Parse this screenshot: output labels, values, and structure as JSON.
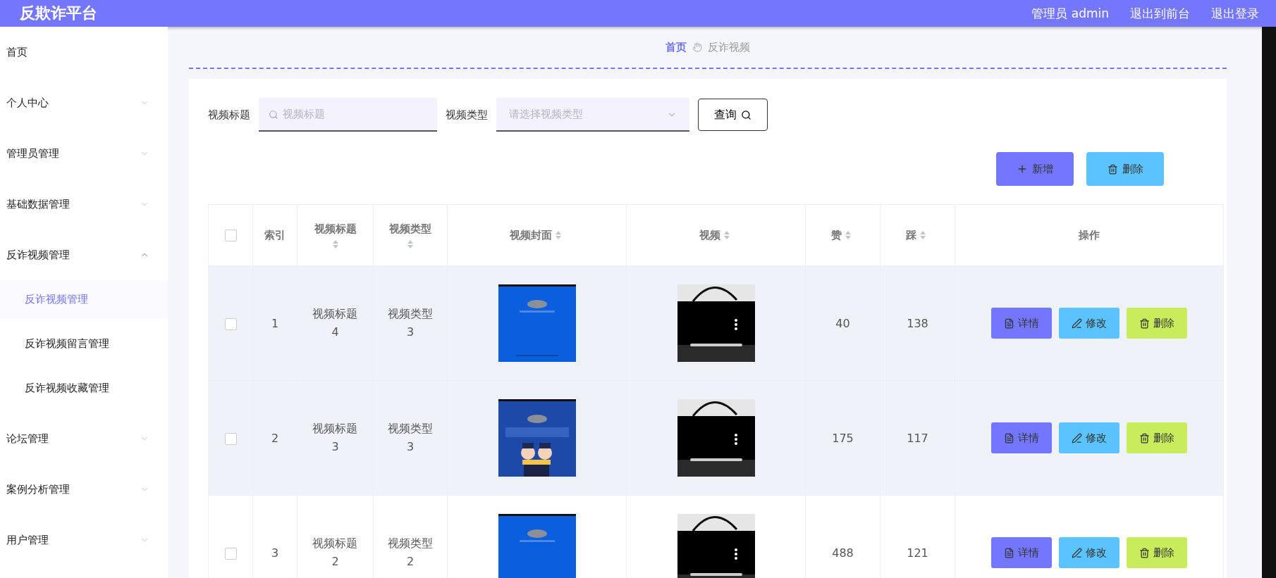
{
  "header": {
    "title": "反欺诈平台",
    "user": "管理员 admin",
    "links": [
      "退出到前台",
      "退出登录"
    ]
  },
  "sidebar": {
    "items": [
      {
        "label": "首页"
      },
      {
        "label": "个人中心",
        "expanded": false
      },
      {
        "label": "管理员管理",
        "expanded": false
      },
      {
        "label": "基础数据管理",
        "expanded": false
      },
      {
        "label": "反诈视频管理",
        "expanded": true,
        "children": [
          {
            "label": "反诈视频管理",
            "selected": true
          },
          {
            "label": "反诈视频留言管理",
            "selected": false
          },
          {
            "label": "反诈视频收藏管理",
            "selected": false
          }
        ]
      },
      {
        "label": "论坛管理",
        "expanded": false
      },
      {
        "label": "案例分析管理",
        "expanded": false
      },
      {
        "label": "用户管理",
        "expanded": false
      }
    ]
  },
  "breadcrumb": [
    "首页",
    "反诈视频"
  ],
  "search": {
    "title_label": "视频标题",
    "title_placeholder": "视频标题",
    "type_label": "视频类型",
    "type_placeholder": "请选择视频类型",
    "query_button": "查询"
  },
  "actions": [
    "新增",
    "删除"
  ],
  "table": {
    "select_all_checked": false,
    "columns": [
      {
        "label": "索引",
        "sortable": false
      },
      {
        "label": "视频标题",
        "sortable": true
      },
      {
        "label": "视频类型",
        "sortable": true
      },
      {
        "label": "视频封面",
        "sortable": true
      },
      {
        "label": "视频",
        "sortable": true
      },
      {
        "label": "赞",
        "sortable": true
      },
      {
        "label": "踩",
        "sortable": true
      },
      {
        "label": "操作",
        "sortable": false
      }
    ],
    "rows": [
      {
        "checked": false,
        "highlighted": true,
        "index": "1",
        "title": "视频标题4",
        "type": "视频类型3",
        "likes": "40",
        "dislikes": "138",
        "buttons": [
          "详情",
          "修改",
          "删除"
        ]
      },
      {
        "checked": false,
        "highlighted": true,
        "index": "2",
        "title": "视频标题3",
        "type": "视频类型3",
        "likes": "175",
        "dislikes": "117",
        "buttons": [
          "详情",
          "修改",
          "删除"
        ]
      },
      {
        "checked": false,
        "highlighted": false,
        "index": "3",
        "title": "视频标题2",
        "type": "视频类型2",
        "likes": "488",
        "dislikes": "121",
        "buttons": [
          "详情",
          "修改",
          "删除"
        ]
      }
    ]
  }
}
